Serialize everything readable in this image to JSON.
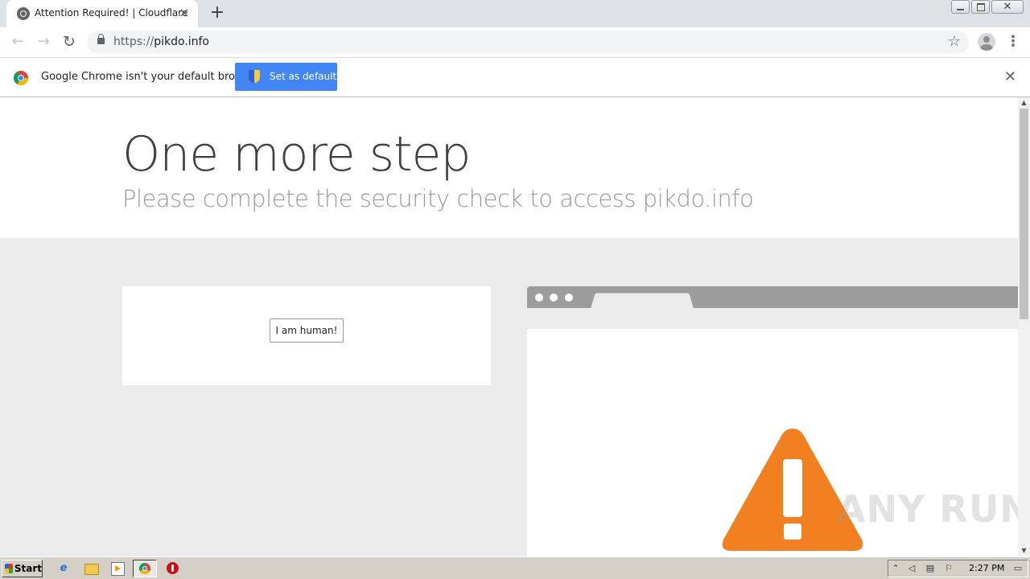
{
  "browser": {
    "tab_title": "Attention Required! | Cloudflare",
    "url_scheme": "https://",
    "url_host": "pikdo.info"
  },
  "infobar": {
    "message": "Google Chrome isn't your default browser",
    "button_label": "Set as default"
  },
  "page": {
    "heading": "One more step",
    "subheading": "Please complete the security check to access pikdo.info",
    "captcha_button": "I am human!"
  },
  "watermark": "ANY RUN",
  "taskbar": {
    "start_label": "Start",
    "clock": "2:27 PM"
  },
  "colors": {
    "warning_orange": "#f38020",
    "infobar_button": "#4285f4"
  }
}
